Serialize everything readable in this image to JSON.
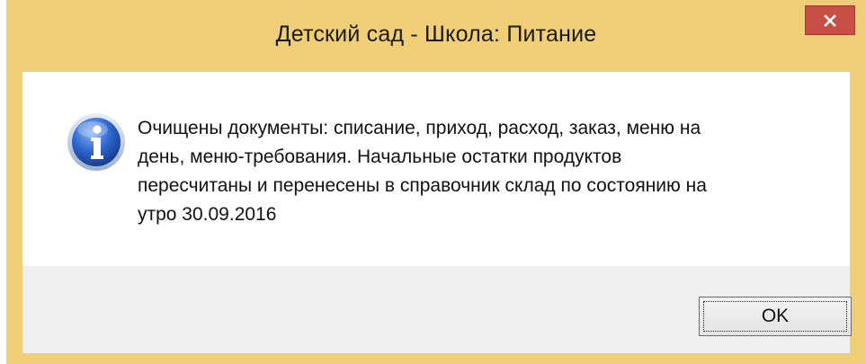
{
  "window": {
    "title": "Детский сад - Школа: Питание"
  },
  "title_bar": {
    "close_icon": "close-icon",
    "close_color": "#c74f45",
    "frame_color": "#f0ce77"
  },
  "dialog": {
    "icon": "info-icon",
    "message": "Очищены документы: списание, приход, расход, заказ, меню на\nдень, меню-требования. Начальные остатки продуктов\nпересчитаны и перенесены в справочник склад по состоянию на\nутро 30.09.2016",
    "ok_label": "OK"
  }
}
